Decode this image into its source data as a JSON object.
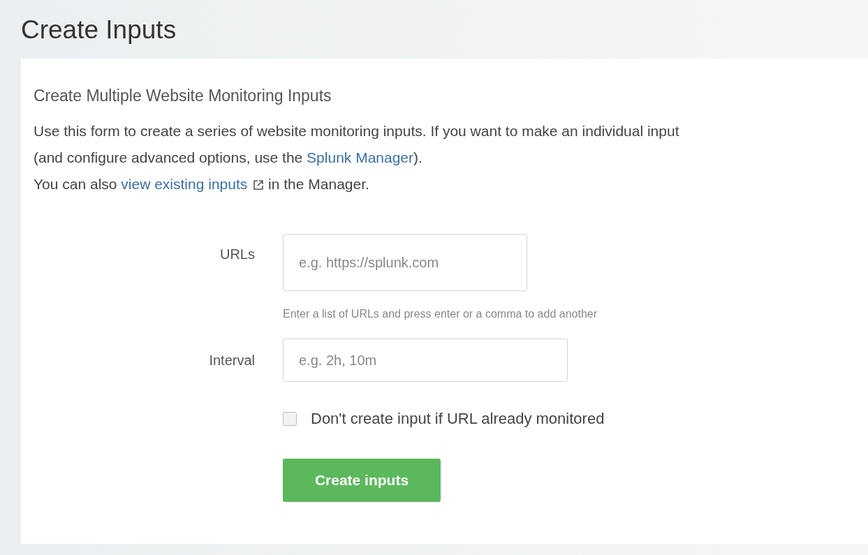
{
  "page": {
    "title": "Create Inputs"
  },
  "panel": {
    "heading": "Create Multiple Website Monitoring Inputs",
    "intro": [
      [
        {
          "kind": "text",
          "text": "Use this form to create a series of website monitoring inputs. If you want to make an individual input (and configure advanced options, use the "
        },
        {
          "kind": "link",
          "text": "Splunk Manager"
        },
        {
          "kind": "text",
          "text": ")."
        }
      ],
      [
        {
          "kind": "text",
          "text": "You can also "
        },
        {
          "kind": "link",
          "text": "view existing inputs"
        },
        {
          "kind": "external-icon"
        },
        {
          "kind": "text",
          "text": " in the Manager."
        }
      ]
    ],
    "fields": [
      {
        "kind": "tall",
        "label": "URLs",
        "placeholder": "e.g. https://splunk.com",
        "help": "Enter a list of URLs and press enter or a comma to add another"
      },
      {
        "kind": "short",
        "label": "Interval",
        "placeholder": "e.g. 2h, 10m"
      }
    ],
    "checkbox": {
      "label": "Don't create input if URL already monitored",
      "checked": false
    },
    "submit": "Create inputs"
  }
}
